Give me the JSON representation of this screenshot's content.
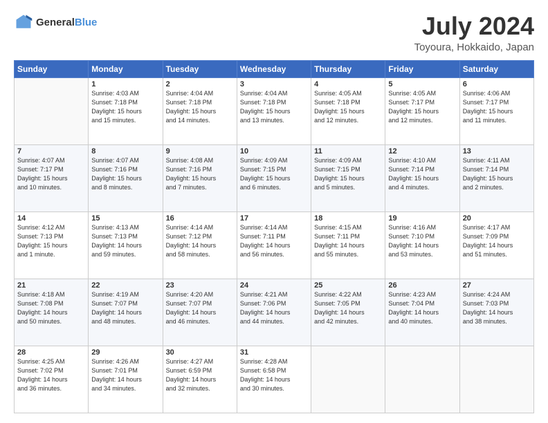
{
  "header": {
    "logo_line1": "General",
    "logo_line2": "Blue",
    "title": "July 2024",
    "subtitle": "Toyoura, Hokkaido, Japan"
  },
  "days_of_week": [
    "Sunday",
    "Monday",
    "Tuesday",
    "Wednesday",
    "Thursday",
    "Friday",
    "Saturday"
  ],
  "weeks": [
    [
      {
        "day": "",
        "info": ""
      },
      {
        "day": "1",
        "info": "Sunrise: 4:03 AM\nSunset: 7:18 PM\nDaylight: 15 hours\nand 15 minutes."
      },
      {
        "day": "2",
        "info": "Sunrise: 4:04 AM\nSunset: 7:18 PM\nDaylight: 15 hours\nand 14 minutes."
      },
      {
        "day": "3",
        "info": "Sunrise: 4:04 AM\nSunset: 7:18 PM\nDaylight: 15 hours\nand 13 minutes."
      },
      {
        "day": "4",
        "info": "Sunrise: 4:05 AM\nSunset: 7:18 PM\nDaylight: 15 hours\nand 12 minutes."
      },
      {
        "day": "5",
        "info": "Sunrise: 4:05 AM\nSunset: 7:17 PM\nDaylight: 15 hours\nand 12 minutes."
      },
      {
        "day": "6",
        "info": "Sunrise: 4:06 AM\nSunset: 7:17 PM\nDaylight: 15 hours\nand 11 minutes."
      }
    ],
    [
      {
        "day": "7",
        "info": "Sunrise: 4:07 AM\nSunset: 7:17 PM\nDaylight: 15 hours\nand 10 minutes."
      },
      {
        "day": "8",
        "info": "Sunrise: 4:07 AM\nSunset: 7:16 PM\nDaylight: 15 hours\nand 8 minutes."
      },
      {
        "day": "9",
        "info": "Sunrise: 4:08 AM\nSunset: 7:16 PM\nDaylight: 15 hours\nand 7 minutes."
      },
      {
        "day": "10",
        "info": "Sunrise: 4:09 AM\nSunset: 7:15 PM\nDaylight: 15 hours\nand 6 minutes."
      },
      {
        "day": "11",
        "info": "Sunrise: 4:09 AM\nSunset: 7:15 PM\nDaylight: 15 hours\nand 5 minutes."
      },
      {
        "day": "12",
        "info": "Sunrise: 4:10 AM\nSunset: 7:14 PM\nDaylight: 15 hours\nand 4 minutes."
      },
      {
        "day": "13",
        "info": "Sunrise: 4:11 AM\nSunset: 7:14 PM\nDaylight: 15 hours\nand 2 minutes."
      }
    ],
    [
      {
        "day": "14",
        "info": "Sunrise: 4:12 AM\nSunset: 7:13 PM\nDaylight: 15 hours\nand 1 minute."
      },
      {
        "day": "15",
        "info": "Sunrise: 4:13 AM\nSunset: 7:13 PM\nDaylight: 14 hours\nand 59 minutes."
      },
      {
        "day": "16",
        "info": "Sunrise: 4:14 AM\nSunset: 7:12 PM\nDaylight: 14 hours\nand 58 minutes."
      },
      {
        "day": "17",
        "info": "Sunrise: 4:14 AM\nSunset: 7:11 PM\nDaylight: 14 hours\nand 56 minutes."
      },
      {
        "day": "18",
        "info": "Sunrise: 4:15 AM\nSunset: 7:11 PM\nDaylight: 14 hours\nand 55 minutes."
      },
      {
        "day": "19",
        "info": "Sunrise: 4:16 AM\nSunset: 7:10 PM\nDaylight: 14 hours\nand 53 minutes."
      },
      {
        "day": "20",
        "info": "Sunrise: 4:17 AM\nSunset: 7:09 PM\nDaylight: 14 hours\nand 51 minutes."
      }
    ],
    [
      {
        "day": "21",
        "info": "Sunrise: 4:18 AM\nSunset: 7:08 PM\nDaylight: 14 hours\nand 50 minutes."
      },
      {
        "day": "22",
        "info": "Sunrise: 4:19 AM\nSunset: 7:07 PM\nDaylight: 14 hours\nand 48 minutes."
      },
      {
        "day": "23",
        "info": "Sunrise: 4:20 AM\nSunset: 7:07 PM\nDaylight: 14 hours\nand 46 minutes."
      },
      {
        "day": "24",
        "info": "Sunrise: 4:21 AM\nSunset: 7:06 PM\nDaylight: 14 hours\nand 44 minutes."
      },
      {
        "day": "25",
        "info": "Sunrise: 4:22 AM\nSunset: 7:05 PM\nDaylight: 14 hours\nand 42 minutes."
      },
      {
        "day": "26",
        "info": "Sunrise: 4:23 AM\nSunset: 7:04 PM\nDaylight: 14 hours\nand 40 minutes."
      },
      {
        "day": "27",
        "info": "Sunrise: 4:24 AM\nSunset: 7:03 PM\nDaylight: 14 hours\nand 38 minutes."
      }
    ],
    [
      {
        "day": "28",
        "info": "Sunrise: 4:25 AM\nSunset: 7:02 PM\nDaylight: 14 hours\nand 36 minutes."
      },
      {
        "day": "29",
        "info": "Sunrise: 4:26 AM\nSunset: 7:01 PM\nDaylight: 14 hours\nand 34 minutes."
      },
      {
        "day": "30",
        "info": "Sunrise: 4:27 AM\nSunset: 6:59 PM\nDaylight: 14 hours\nand 32 minutes."
      },
      {
        "day": "31",
        "info": "Sunrise: 4:28 AM\nSunset: 6:58 PM\nDaylight: 14 hours\nand 30 minutes."
      },
      {
        "day": "",
        "info": ""
      },
      {
        "day": "",
        "info": ""
      },
      {
        "day": "",
        "info": ""
      }
    ]
  ]
}
